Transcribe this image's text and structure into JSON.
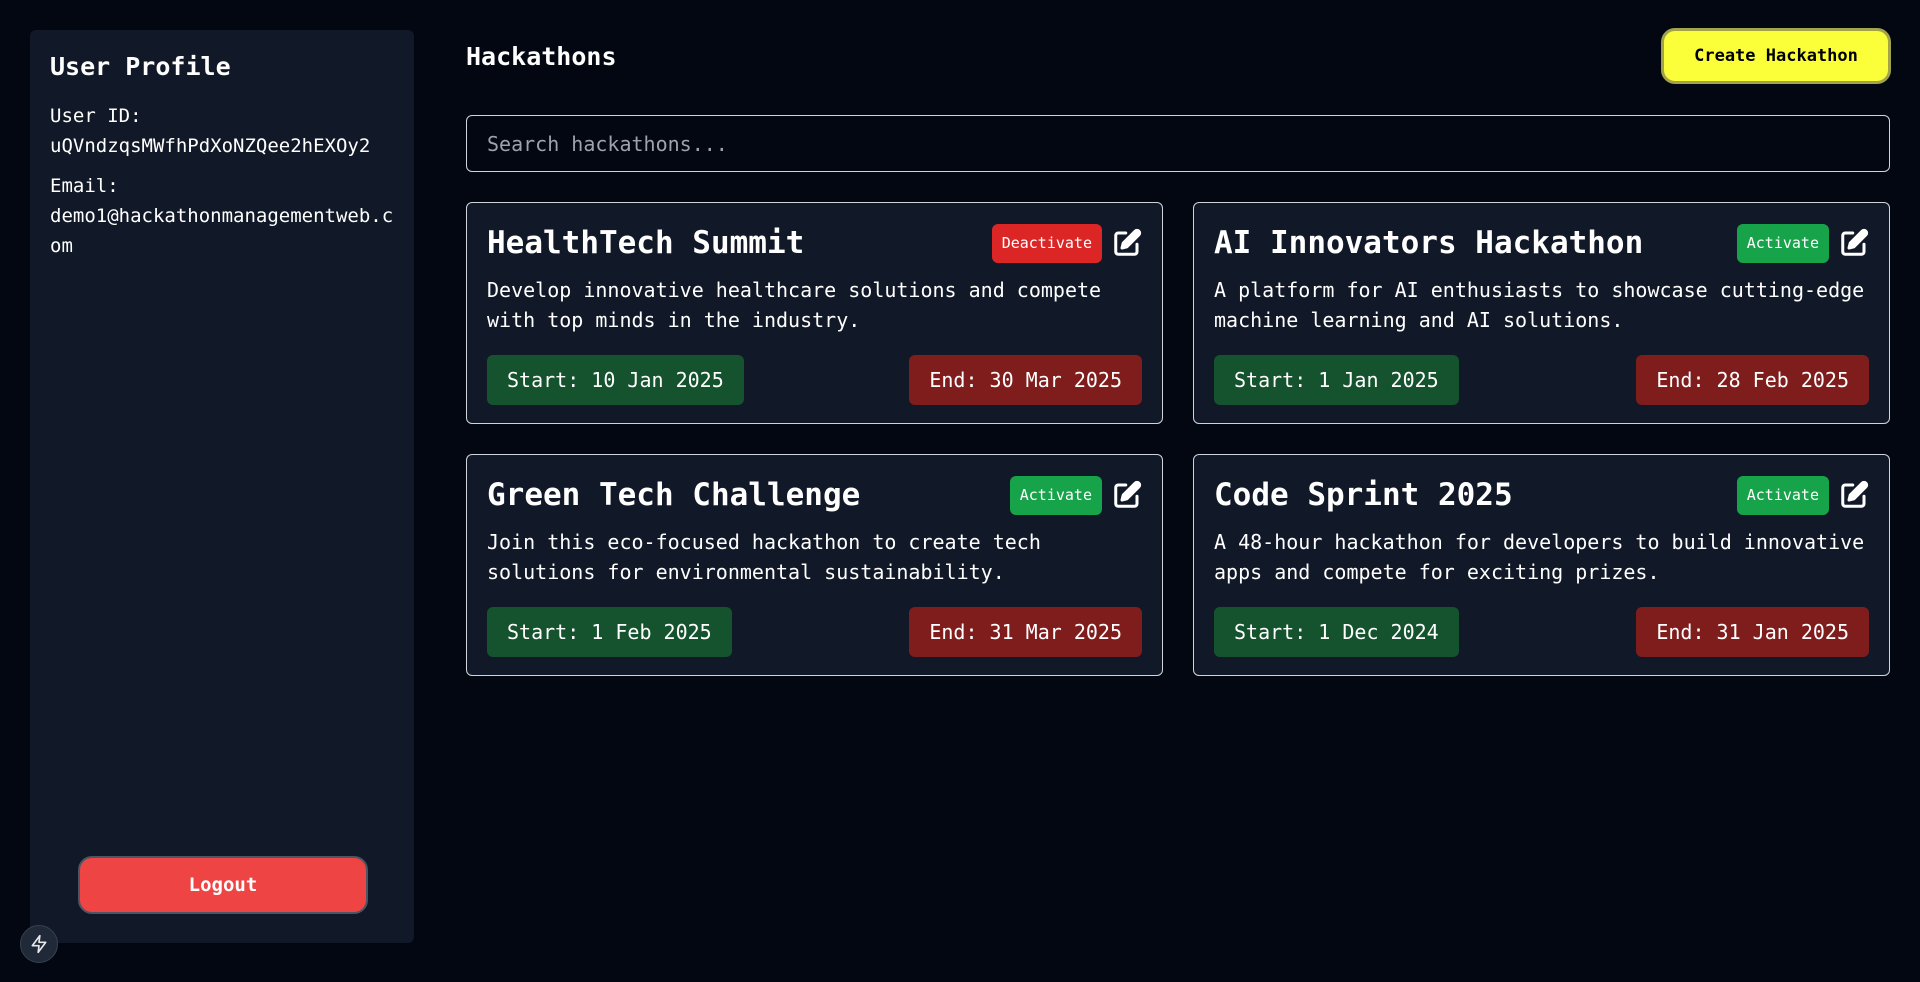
{
  "sidebar": {
    "title": "User Profile",
    "user_id_label": "User ID:",
    "user_id": "uQVndzqsMWfhPdXoNZQee2hEXOy2",
    "email_label": "Email:",
    "email": "demo1@hackathonmanagementweb.com",
    "logout_label": "Logout"
  },
  "header": {
    "title": "Hackathons",
    "create_label": "Create Hackathon"
  },
  "search": {
    "placeholder": "Search hackathons..."
  },
  "colors": {
    "activate": "#16a34a",
    "deactivate": "#dc2626",
    "start_pill": "#14532d",
    "end_pill": "#7f1d1d",
    "accent_create": "#fbff3a",
    "logout": "#ef4444"
  },
  "hackathons": [
    {
      "title": "HealthTech Summit",
      "description": "Develop innovative healthcare solutions and compete with top minds in the industry.",
      "toggle_label": "Deactivate",
      "toggle_state": "deactivate",
      "start": "Start: 10 Jan 2025",
      "end": "End: 30 Mar 2025"
    },
    {
      "title": "AI Innovators Hackathon",
      "description": "A platform for AI enthusiasts to showcase cutting-edge machine learning and AI solutions.",
      "toggle_label": "Activate",
      "toggle_state": "activate",
      "start": "Start: 1 Jan 2025",
      "end": "End: 28 Feb 2025"
    },
    {
      "title": "Green Tech Challenge",
      "description": "Join this eco-focused hackathon to create tech solutions for environmental sustainability.",
      "toggle_label": "Activate",
      "toggle_state": "activate",
      "start": "Start: 1 Feb 2025",
      "end": "End: 31 Mar 2025"
    },
    {
      "title": "Code Sprint 2025",
      "description": "A 48-hour hackathon for developers to build innovative apps and compete for exciting prizes.",
      "toggle_label": "Activate",
      "toggle_state": "activate",
      "start": "Start: 1 Dec 2024",
      "end": "End: 31 Jan 2025"
    }
  ],
  "icons": {
    "edit": "edit-icon",
    "fab": "lightning-icon"
  }
}
